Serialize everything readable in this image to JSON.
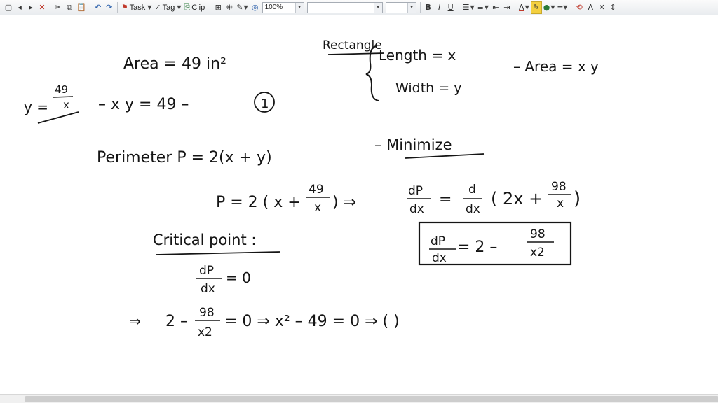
{
  "toolbar": {
    "task_label": "Task",
    "tag_label": "Tag",
    "clip_label": "Clip",
    "zoom_value": "100%",
    "style_value": "",
    "size_value": "",
    "bold_label": "B",
    "italic_label": "I",
    "underline_label": "U",
    "font_color_label": "A",
    "icons": [
      "new-page-icon",
      "back-icon",
      "forward-icon",
      "delete-icon",
      "cut-icon",
      "copy-icon",
      "paste-icon",
      "undo-icon",
      "redo-icon",
      "flag-icon",
      "tag-icon",
      "clip-icon",
      "table-icon",
      "insert-picture-icon",
      "pen-icon",
      "globe-icon",
      "bullets-icon",
      "numbering-icon",
      "decrease-indent-icon",
      "increase-indent-icon",
      "highlighter-icon",
      "color-fill-icon",
      "line-style-icon",
      "lasso-icon",
      "text-icon",
      "close-icon",
      "move-icon"
    ]
  },
  "notes": {
    "rect_label": "Rectangle",
    "length_def": "Length = x",
    "width_def": "Width = y",
    "area_eq": "– Area = x y",
    "area_given": "Area = 49 in²",
    "y_lhs": "y =",
    "y_num": "49",
    "y_den": "x",
    "xy_eq": "– x y = 49 –",
    "eq_number": "1",
    "perimeter_eq": "Perimeter   P = 2(x + y)",
    "minimize": "– Minimize",
    "p_sub_lhs": "P = 2 ( x +",
    "p_sub_num": "49",
    "p_sub_den": "x",
    "p_sub_rhs": ")  ⇒",
    "dp": "dP",
    "dx": "dx",
    "eq": "=",
    "d": "d",
    "deriv_open": "( 2x +",
    "num98": "98",
    "den_x": "x",
    "deriv_close": ")",
    "boxed_rhs": "= 2 –",
    "den_x2": "x2",
    "critical_point": "Critical point :",
    "zero_eq": "= 0",
    "implies": "⇒",
    "final_lhs": "2 –",
    "final_rhs": "= 0   ⇒   x² – 49 = 0   ⇒ ( )"
  }
}
